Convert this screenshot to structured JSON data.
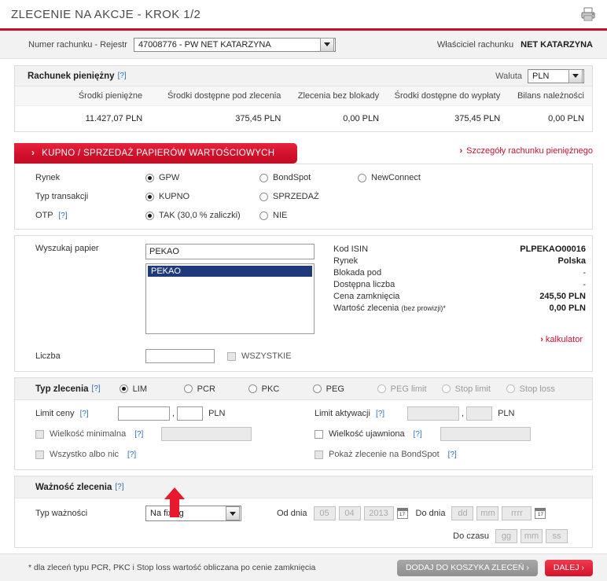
{
  "header": {
    "title": "ZLECENIE NA AKCJE - KROK 1/2",
    "print_icon": "printer-icon"
  },
  "account_bar": {
    "label": "Numer rachunku - Rejestr",
    "selected": "47008776 - PW NET KATARZYNA",
    "owner_label": "Właściciel rachunku",
    "owner_value": "NET KATARZYNA"
  },
  "money_panel": {
    "title": "Rachunek pieniężny",
    "hint": "[?]",
    "currency_label": "Waluta",
    "currency_value": "PLN",
    "columns": [
      "Środki pieniężne",
      "Środki dostępne pod zlecenia",
      "Zlecenia bez blokady",
      "Środki dostępne do wypłaty",
      "Bilans należności"
    ],
    "values": [
      "11.427,07  PLN",
      "375,45  PLN",
      "0,00  PLN",
      "375,45  PLN",
      "0,00  PLN"
    ]
  },
  "section": {
    "tab_label": "KUPNO / SPRZEDAŻ PAPIERÓW WARTOŚCIOWYCH",
    "chevron": "›",
    "details_link": "Szczegóły rachunku pieniężnego"
  },
  "market_row": {
    "label": "Rynek",
    "options": [
      {
        "label": "GPW",
        "selected": true
      },
      {
        "label": "BondSpot",
        "selected": false
      },
      {
        "label": "NewConnect",
        "selected": false
      }
    ]
  },
  "transaction_row": {
    "label": "Typ transakcji",
    "options": [
      {
        "label": "KUPNO",
        "selected": true
      },
      {
        "label": "SPRZEDAŻ",
        "selected": false
      }
    ]
  },
  "otp_row": {
    "label": "OTP",
    "hint": "[?]",
    "options": [
      {
        "label": "TAK (30,0 % zaliczki)",
        "selected": true
      },
      {
        "label": "NIE",
        "selected": false
      }
    ]
  },
  "search": {
    "label": "Wyszukaj papier",
    "value": "PEKAO",
    "listbox_selected": "PEKAO",
    "quantity_label": "Liczba",
    "quantity_value": "",
    "all_checkbox_label": "WSZYSTKIE",
    "all_checkbox_checked": false,
    "calculator_link": "kalkulator"
  },
  "instrument": {
    "rows": [
      {
        "key": "Kod ISIN",
        "value": "PLPEKAO00016",
        "bold": true
      },
      {
        "key": "Rynek",
        "value": "Polska",
        "bold": true
      },
      {
        "key": "Blokada pod",
        "value": "-",
        "bold": false
      },
      {
        "key": "Dostępna liczba",
        "value": "-",
        "bold": false
      },
      {
        "key": "Cena zamknięcia",
        "value": "245,50 PLN",
        "bold": true
      },
      {
        "key": "Wartość zlecenia",
        "key_sub": "(bez prowizji)*",
        "value": "0,00 PLN",
        "bold": true
      }
    ]
  },
  "order_type": {
    "label": "Typ zlecenia",
    "hint": "[?]",
    "options": [
      {
        "label": "LIM",
        "selected": true,
        "disabled": false
      },
      {
        "label": "PCR",
        "selected": false,
        "disabled": false
      },
      {
        "label": "PKC",
        "selected": false,
        "disabled": false
      },
      {
        "label": "PEG",
        "selected": false,
        "disabled": false
      },
      {
        "label": "PEG limit",
        "selected": false,
        "disabled": true
      },
      {
        "label": "Stop limit",
        "selected": false,
        "disabled": true
      },
      {
        "label": "Stop loss",
        "selected": false,
        "disabled": true
      }
    ]
  },
  "limits": {
    "price_label": "Limit ceny",
    "price_hint": "[?]",
    "price_int": "",
    "price_dec": "",
    "price_currency": "PLN",
    "activation_label": "Limit aktywacji",
    "activation_hint": "[?]",
    "activation_int": "",
    "activation_dec": "",
    "activation_currency": "PLN",
    "checkboxes": [
      {
        "label": "Wielkość minimalna",
        "hint": "[?]",
        "checked": false,
        "disabled": true,
        "has_field": true
      },
      {
        "label": "Wszystko albo nic",
        "hint": "[?]",
        "checked": false,
        "disabled": true,
        "has_field": false
      },
      {
        "label": "Wielkość ujawniona",
        "hint": "[?]",
        "checked": false,
        "disabled": false,
        "has_field": true
      },
      {
        "label": "Pokaż zlecenie na BondSpot",
        "hint": "[?]",
        "checked": false,
        "disabled": true,
        "has_field": false
      }
    ]
  },
  "validity": {
    "title": "Ważność zlecenia",
    "hint": "[?]",
    "type_label": "Typ ważności",
    "type_value": "Na fixing",
    "from_label": "Od dnia",
    "from_day": "05",
    "from_month": "04",
    "from_year": "2013",
    "to_label": "Do dnia",
    "to_day_ph": "dd",
    "to_month_ph": "mm",
    "to_year_ph": "rrrr",
    "time_label": "Do czasu",
    "time_hh_ph": "gg",
    "time_mm_ph": "mm",
    "time_ss_ph": "ss",
    "calendar_icon_label": "17"
  },
  "footer": {
    "note": "* dla zleceń typu PCR, PKC i Stop loss wartość obliczana po cenie zamknięcia",
    "basket_button": "DODAJ DO KOSZYKA ZLECEŃ ›",
    "next_button": "DALEJ ›"
  },
  "annotation": {
    "arrow": "red-up-arrow pointing at validity type dropdown"
  }
}
